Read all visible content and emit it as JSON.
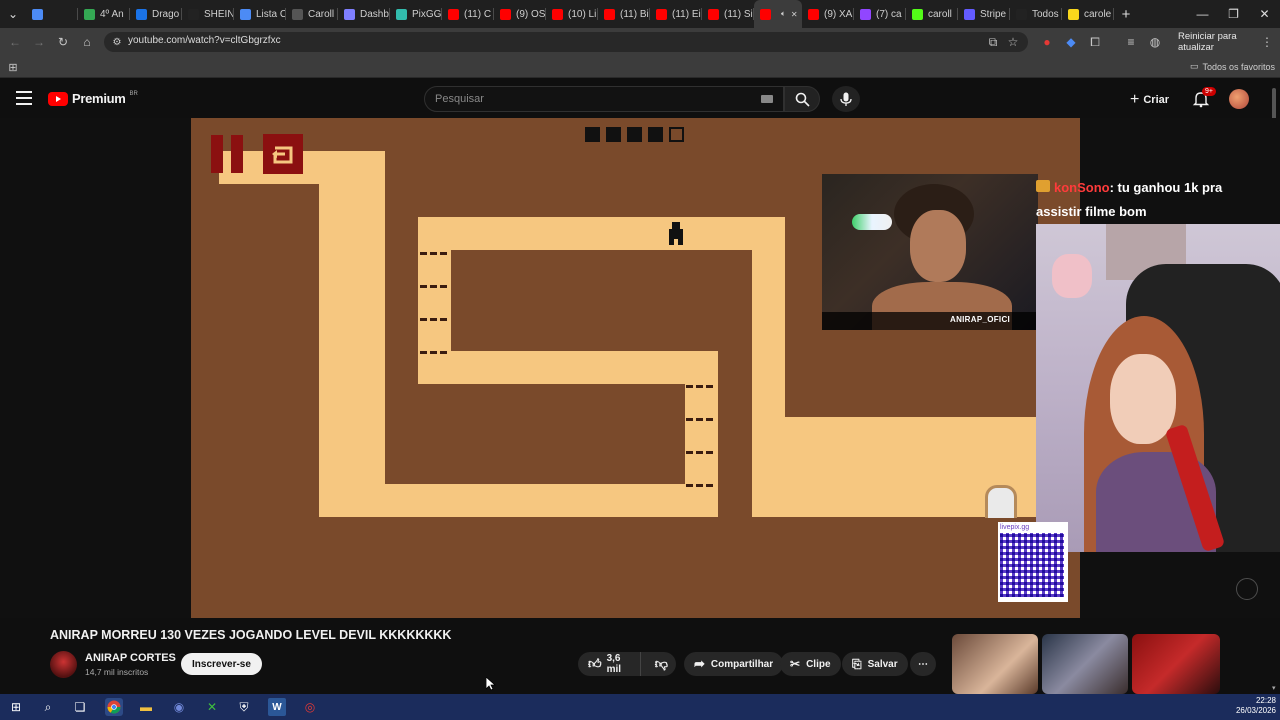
{
  "browser": {
    "tabs": [
      {
        "label": "",
        "color": "#4c8bf5"
      },
      {
        "label": "4º An",
        "color": "#34a853"
      },
      {
        "label": "Drago",
        "color": "#1a73e8"
      },
      {
        "label": "SHEIN",
        "color": "#222222"
      },
      {
        "label": "Lista C",
        "color": "#4c8bf5"
      },
      {
        "label": "Caroll",
        "color": "#555555"
      },
      {
        "label": "Dashb",
        "color": "#7f7fff"
      },
      {
        "label": "PixGG",
        "color": "#32bcad"
      },
      {
        "label": "(11) C",
        "color": "#ff0000"
      },
      {
        "label": "(9) OS",
        "color": "#ff0000"
      },
      {
        "label": "(10) Li",
        "color": "#ff0000"
      },
      {
        "label": "(11) Bi",
        "color": "#ff0000"
      },
      {
        "label": "(11) Ei",
        "color": "#ff0000"
      },
      {
        "label": "(11) Si",
        "color": "#ff0000"
      },
      {
        "label": "",
        "color": "#ff0000",
        "active": true
      },
      {
        "label": "(9) XA",
        "color": "#ff0000"
      },
      {
        "label": "(7) ca",
        "color": "#9146ff"
      },
      {
        "label": "caroll",
        "color": "#53fc18"
      },
      {
        "label": "Stripe",
        "color": "#635bff"
      },
      {
        "label": "Todos",
        "color": "#222222"
      },
      {
        "label": "carole",
        "color": "#f9d71c"
      }
    ],
    "url": "youtube.com/watch?v=cltGbgrzfxc",
    "restart_label": "Reiniciar para atualizar",
    "bookmarks_all": "Todos os favoritos"
  },
  "youtube": {
    "brand": "Premium",
    "region": "BR",
    "search_placeholder": "Pesquisar",
    "create_label": "Criar",
    "notif_badge": "9+"
  },
  "video": {
    "chat_user": "konSono",
    "chat_message": ": tu ganhou 1k pra assistir filme bom",
    "streamer_tag": "ANIRAP_OFICI",
    "qr_label": "livepix.gg"
  },
  "info": {
    "title": "ANIRAP MORREU 130 VEZES JOGANDO LEVEL DEVIL KKKKKKKK",
    "channel": "ANIRAP CORTES",
    "subscribers": "14,7 mil inscritos",
    "subscribe_label": "Inscrever-se",
    "likes": "3,6 mil",
    "share_label": "Compartilhar",
    "clip_label": "Clipe",
    "save_label": "Salvar"
  },
  "taskbar": {
    "time": "22:28",
    "date": "26/03/2026"
  },
  "colors": {
    "yt_red": "#ff0000",
    "game_brown": "#7a4a2b",
    "game_path": "#f6c780",
    "taskbar": "#1b2c5c"
  }
}
